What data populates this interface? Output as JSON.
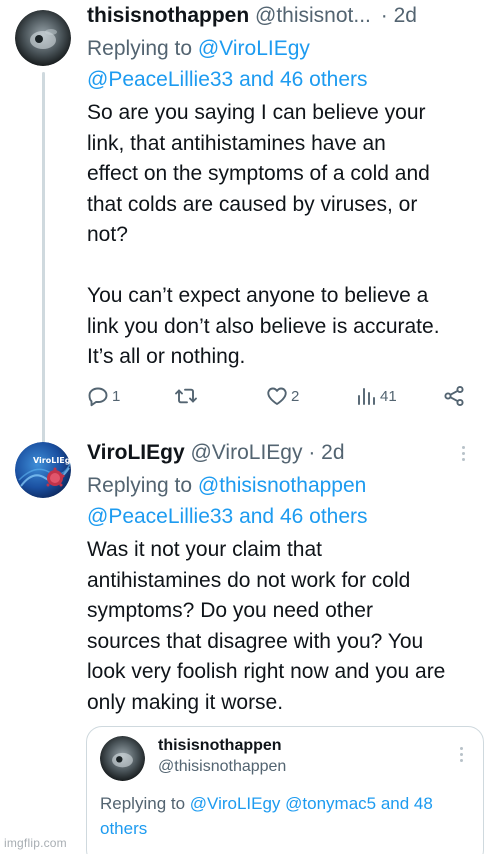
{
  "tweet1": {
    "display_name": "thisisnothappen",
    "handle": "@thisisnot...",
    "separator": "·",
    "time": "2d",
    "replying_prefix": "Replying to ",
    "replying_to_1": "@ViroLIEgy",
    "replying_to_2": "@PeaceLillie33 and 46 others",
    "body": "So are you saying I can believe your\nlink, that antihistamines have an\neffect on the symptoms of a cold and\nthat colds are caused by viruses, or\nnot?\n\nYou can’t expect anyone to believe a\nlink you don’t also believe is accurate.\nIt’s all or nothing.",
    "actions": {
      "reply_icon": "reply-bubble-icon",
      "reply_count": "1",
      "retweet_icon": "retweet-icon",
      "like_icon": "heart-icon",
      "like_count": "2",
      "views_icon": "bar-chart-icon",
      "views_count": "41",
      "share_icon": "share-nodes-icon"
    }
  },
  "tweet2": {
    "display_name": "ViroLIEgy",
    "handle": "@ViroLIEgy",
    "separator": "·",
    "time": "2d",
    "replying_prefix": "Replying to ",
    "replying_to_1": "@thisisnothappen",
    "replying_to_2": "@PeaceLillie33 and 46 others",
    "body": "Was it not your claim that\nantihistamines do not work for cold\nsymptoms? Do you need other\nsources that disagree with you? You\nlook very foolish right now and you are\nonly making it worse.",
    "avatar_text": "ViroLIEgy"
  },
  "quote": {
    "display_name": "thisisnothappen",
    "handle": "@thisisnothappen",
    "replying_prefix": "Replying to ",
    "replying_to": "@ViroLIEgy @tonymac5 and 48 others"
  },
  "watermark": "imgflip.com",
  "colors": {
    "link": "#1d9bf0",
    "secondary_text": "#536471",
    "primary_text": "#0f1419",
    "thread_line": "#cfd9de"
  }
}
